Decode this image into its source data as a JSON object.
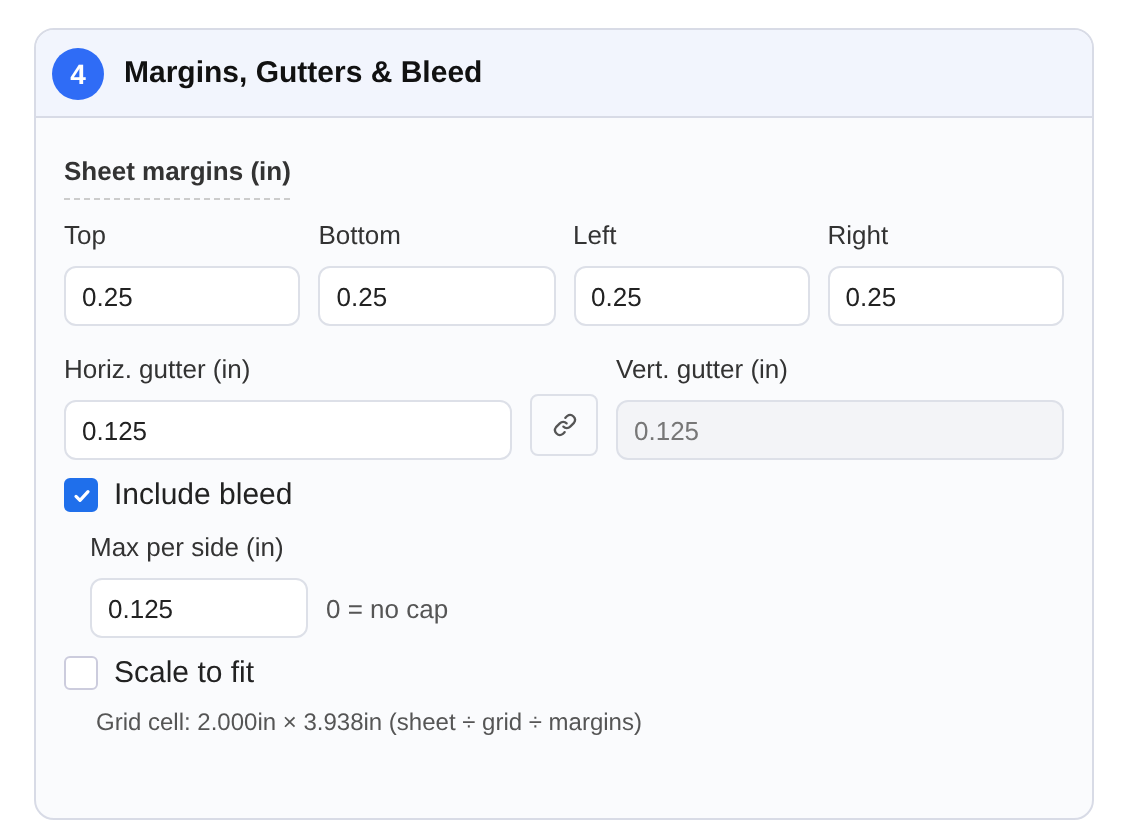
{
  "section": {
    "number": "4",
    "title": "Margins, Gutters & Bleed"
  },
  "sheet_margins": {
    "label": "Sheet margins (in)",
    "fields": [
      {
        "label": "Top",
        "value": "0.25"
      },
      {
        "label": "Bottom",
        "value": "0.25"
      },
      {
        "label": "Left",
        "value": "0.25"
      },
      {
        "label": "Right",
        "value": "0.25"
      }
    ]
  },
  "gutters": {
    "horizontal": {
      "label": "Horiz. gutter (in)",
      "value": "0.125",
      "disabled": false
    },
    "vertical": {
      "label": "Vert. gutter (in)",
      "value": "0.125",
      "disabled": true
    }
  },
  "include_bleed": {
    "label": "Include bleed",
    "checked": true
  },
  "bleed": {
    "label": "Max per side (in)",
    "value": "0.125",
    "hint": "0 = no cap"
  },
  "scale_to_fit": {
    "label": "Scale to fit",
    "checked": false
  },
  "grid_cell_note": "Grid cell: 2.000in × 3.938in (sheet ÷ grid ÷ margins)"
}
